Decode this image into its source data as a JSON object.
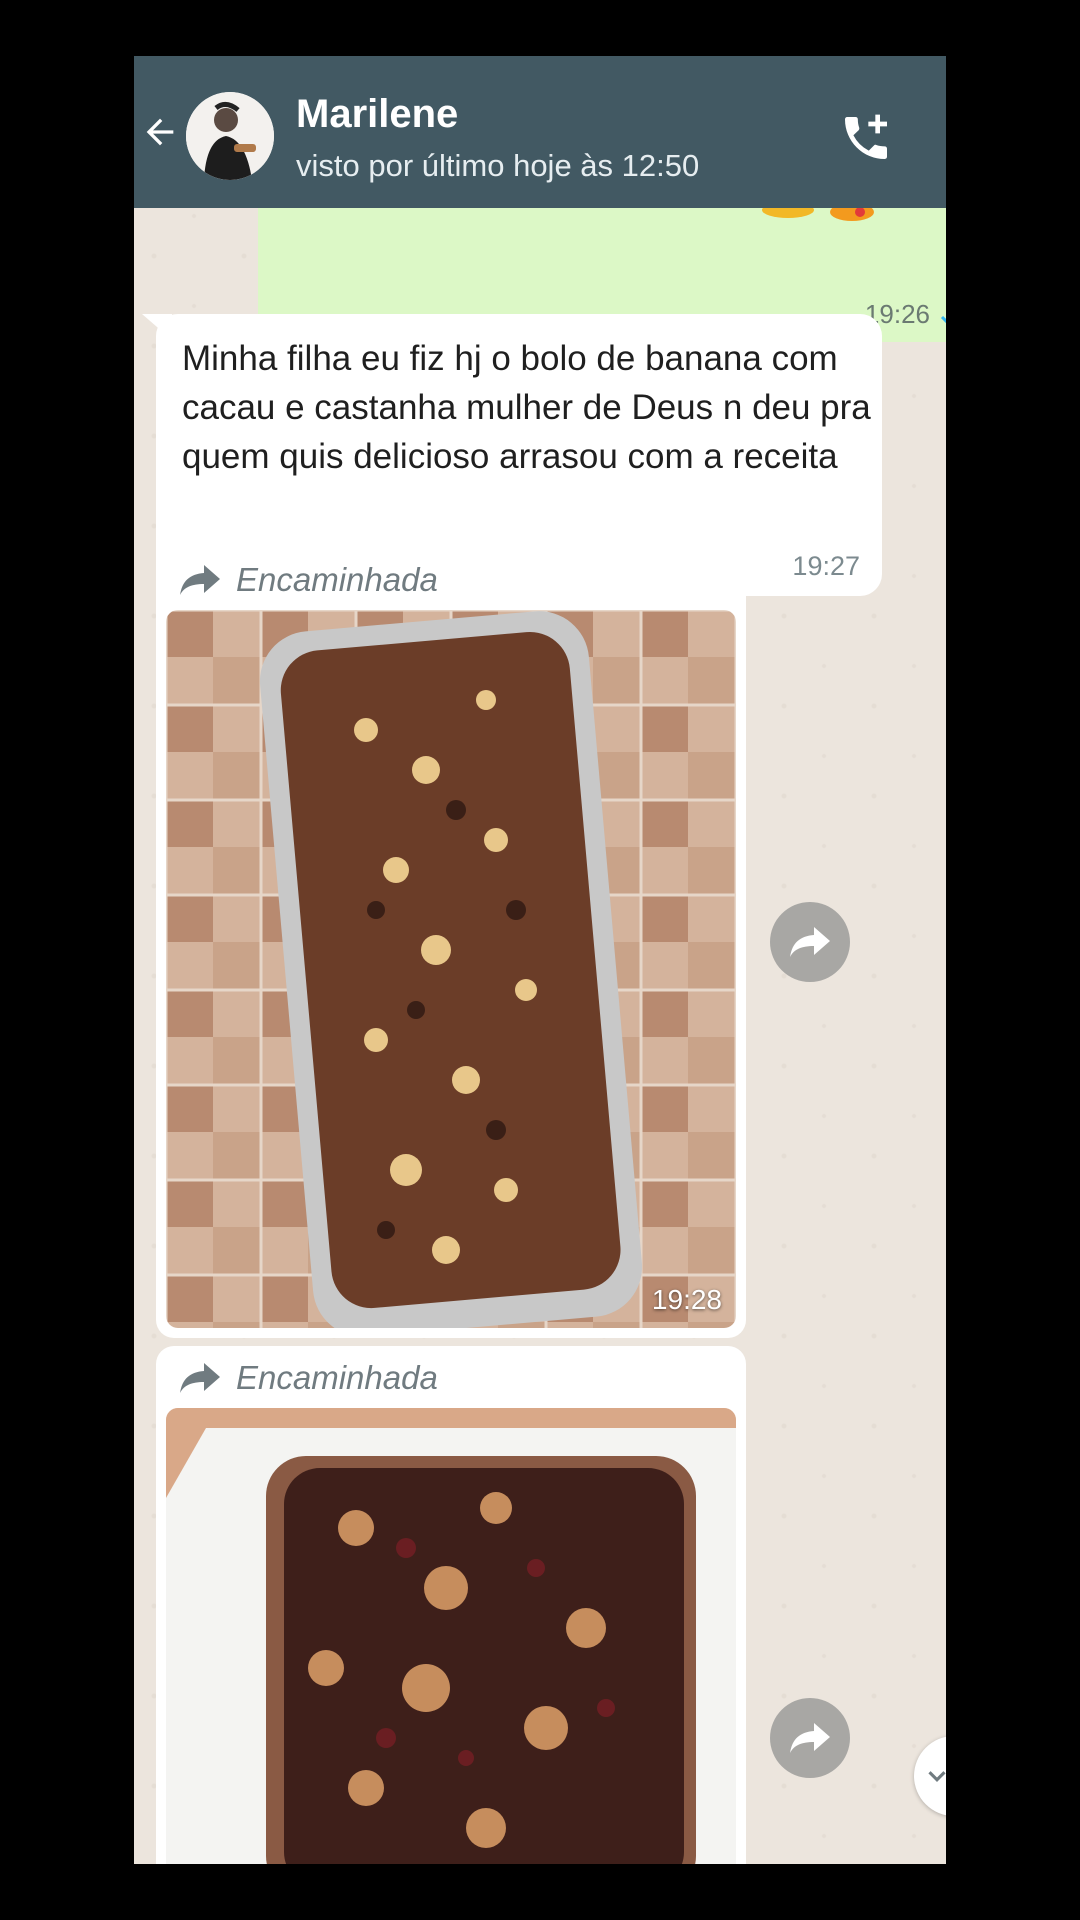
{
  "header": {
    "contact_name": "Marilene",
    "status": "visto por último hoje às 12:50",
    "back_icon": "arrow-left-icon",
    "call_icon": "add-call-icon",
    "color": "#425963"
  },
  "messages": {
    "outgoing_time": "19:26",
    "incoming_text": "Minha filha eu fiz hj o bolo de banana com cacau e castanha mulher de Deus n deu pra quem quis delicioso arrasou com a receita",
    "incoming_time": "19:27",
    "media1": {
      "forwarded_label": "Encaminhada",
      "time": "19:28"
    },
    "media2": {
      "forwarded_label": "Encaminhada"
    }
  },
  "colors": {
    "outgoing_bubble": "#dcf8c6",
    "chat_background": "#ece5dd",
    "read_ticks": "#34b7f1"
  }
}
